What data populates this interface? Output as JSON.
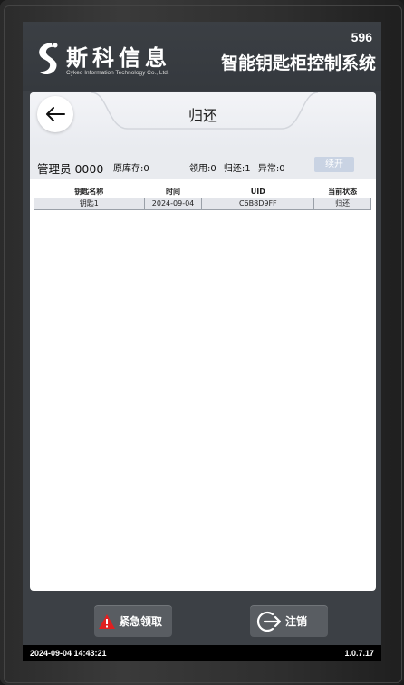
{
  "header": {
    "brand_name": "斯科信息",
    "brand_sub": "Cykeo Information Technology Co., Ltd.",
    "cabinet_no": "596",
    "cabinet_title": "智能钥匙柜控制系统"
  },
  "page": {
    "title": "归还"
  },
  "info": {
    "admin": "管理员 0000",
    "stock": "原库存:0",
    "borrowed": "领用:0",
    "returned": "归还:1",
    "abnormal": "异常:0",
    "continue_label": "续开"
  },
  "table": {
    "headers": [
      "钥匙名称",
      "时间",
      "UID",
      "当前状态"
    ],
    "rows": [
      [
        "钥匙1",
        "2024-09-04",
        "C6B8D9FF",
        "归还"
      ]
    ]
  },
  "buttons": {
    "emergency_label": "紧急领取",
    "logout_label": "注销"
  },
  "status_bar": {
    "datetime": "2024-09-04 14:43:21",
    "version": "1.0.7.17"
  },
  "colors": {
    "header_bg": "#3b3f44",
    "button_bg": "#595d62",
    "warning_red": "#e02020",
    "continue_btn": "#c9d3e3"
  }
}
